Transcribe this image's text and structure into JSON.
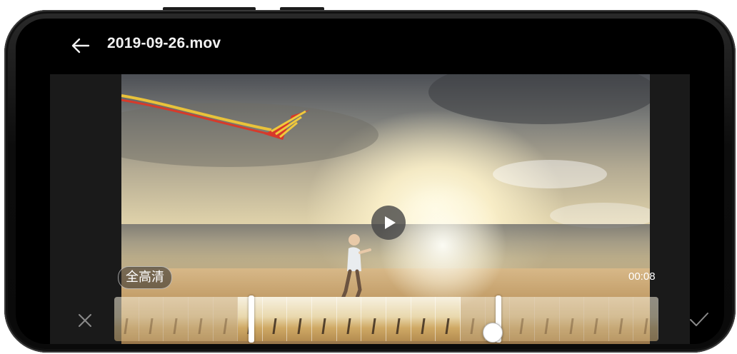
{
  "header": {
    "title": "2019-09-26.mov",
    "back_icon": "arrow-left-icon"
  },
  "video": {
    "quality_label": "全高清",
    "timestamp": "00:08",
    "play_icon": "play-icon"
  },
  "controls": {
    "cancel_icon": "close-icon",
    "confirm_icon": "check-icon"
  },
  "filmstrip": {
    "frame_count": 22,
    "selected_start_frame": 5,
    "selected_end_frame": 14
  },
  "colors": {
    "screen_bg": "#000000",
    "panel_bg": "#1a1a1a",
    "text": "#f2f2f2",
    "handle": "#ffffff"
  }
}
